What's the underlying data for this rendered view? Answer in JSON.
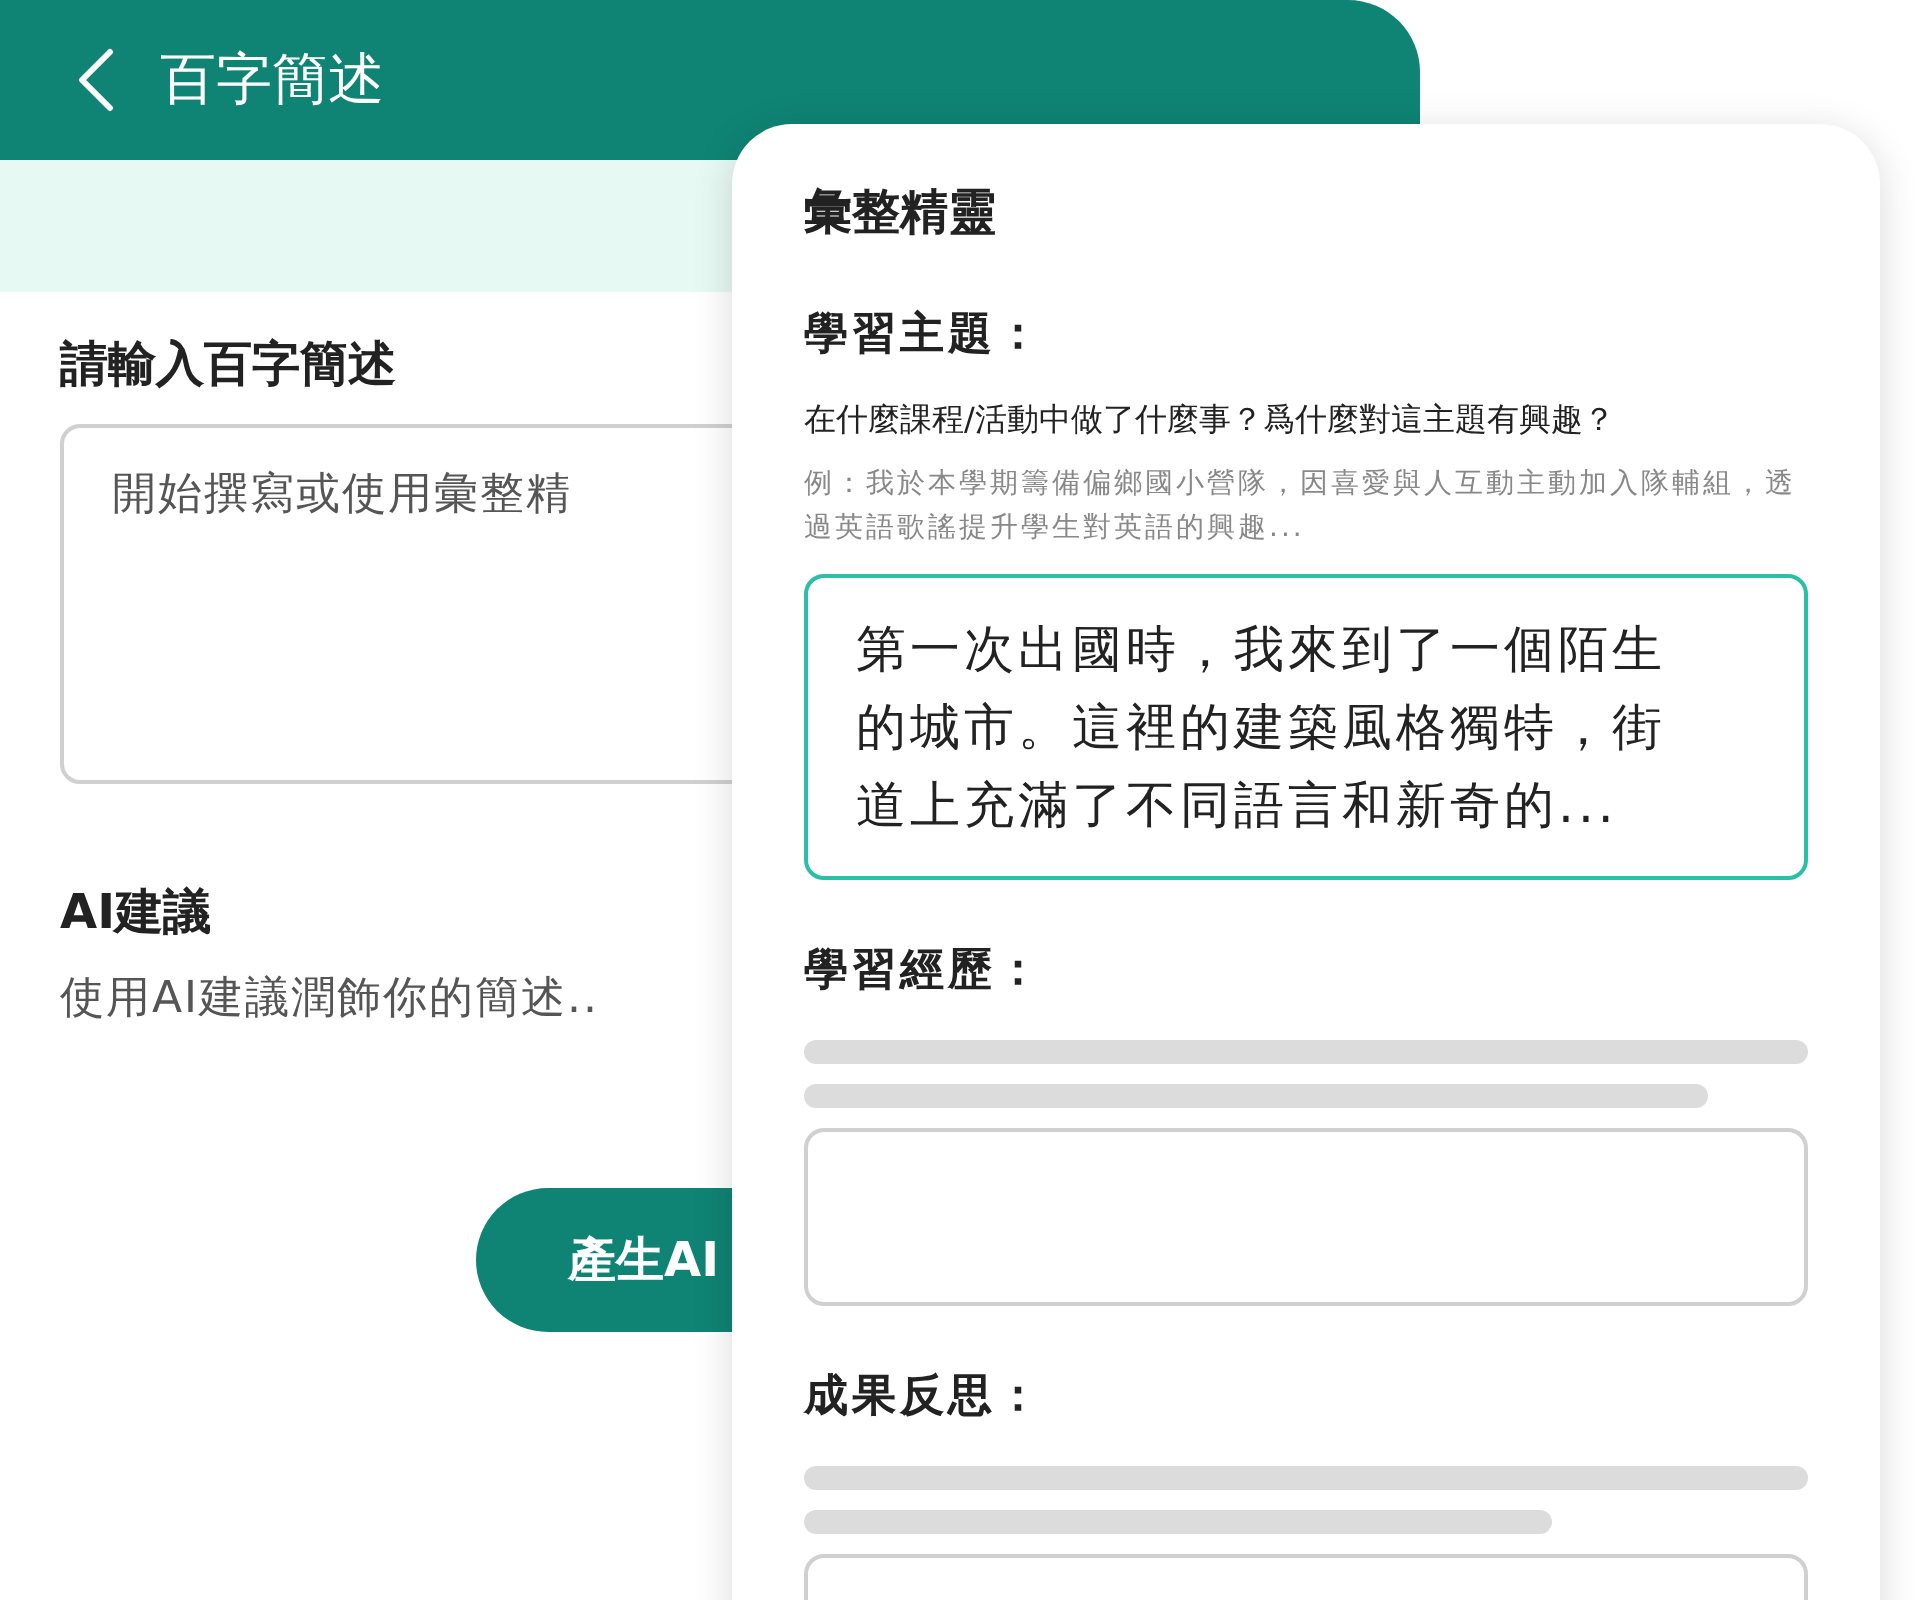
{
  "header": {
    "title": "百字簡述"
  },
  "form": {
    "label": "請輸入百字簡述",
    "placeholder": "開始撰寫或使用彙整精",
    "ai_title": "AI建議",
    "ai_description": "使用AI建議潤飾你的簡述..",
    "button": "產生AI"
  },
  "wizard": {
    "title": "彙整精靈",
    "sections": [
      {
        "kind": "answered",
        "label": "學習主題：",
        "prompt": "在什麼課程/活動中做了什麼事？爲什麼對這主題有興趣？",
        "example": "例：我於本學期籌備偏鄉國小營隊，因喜愛與人互動主動加入隊輔組，透過英語歌謠提升學生對英語的興趣...",
        "value": "第一次出國時，我來到了一個陌生的城市。這裡的建築風格獨特，街道上充滿了不同語言和新奇的..."
      },
      {
        "kind": "pending",
        "label": "學習經歷："
      },
      {
        "kind": "pending",
        "label": "成果反思："
      }
    ]
  }
}
